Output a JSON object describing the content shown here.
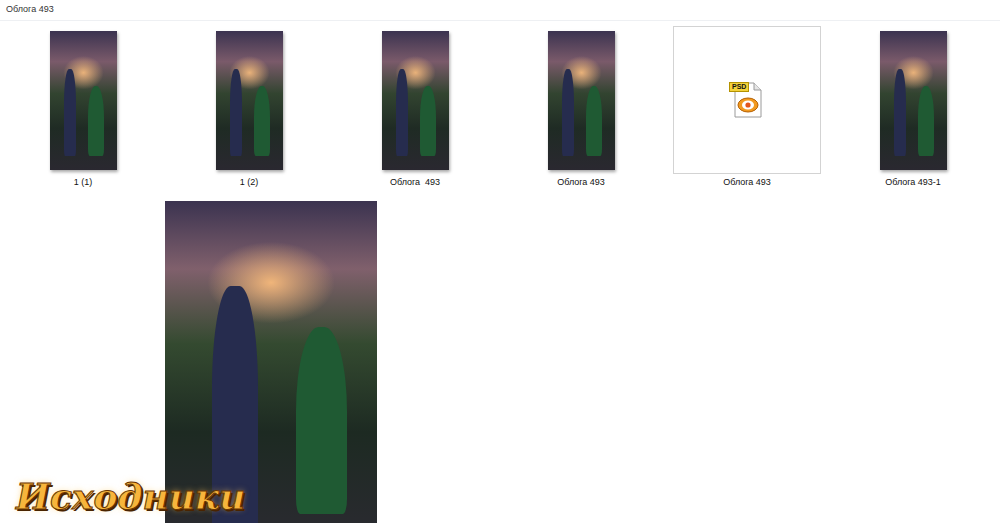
{
  "window": {
    "title": "Облога 493"
  },
  "files": [
    {
      "name": "1 (1)",
      "kind": "image",
      "selected": false
    },
    {
      "name": "1 (2)",
      "kind": "image",
      "selected": false
    },
    {
      "name": "Облога  493",
      "kind": "image",
      "selected": false
    },
    {
      "name": "Облога 493",
      "kind": "image",
      "selected": false
    },
    {
      "name": "Облога 493",
      "kind": "psd",
      "badge": "PSD",
      "selected": true
    },
    {
      "name": "Облога 493-1",
      "kind": "image",
      "selected": false
    }
  ],
  "watermark": {
    "text": "Исходники"
  }
}
